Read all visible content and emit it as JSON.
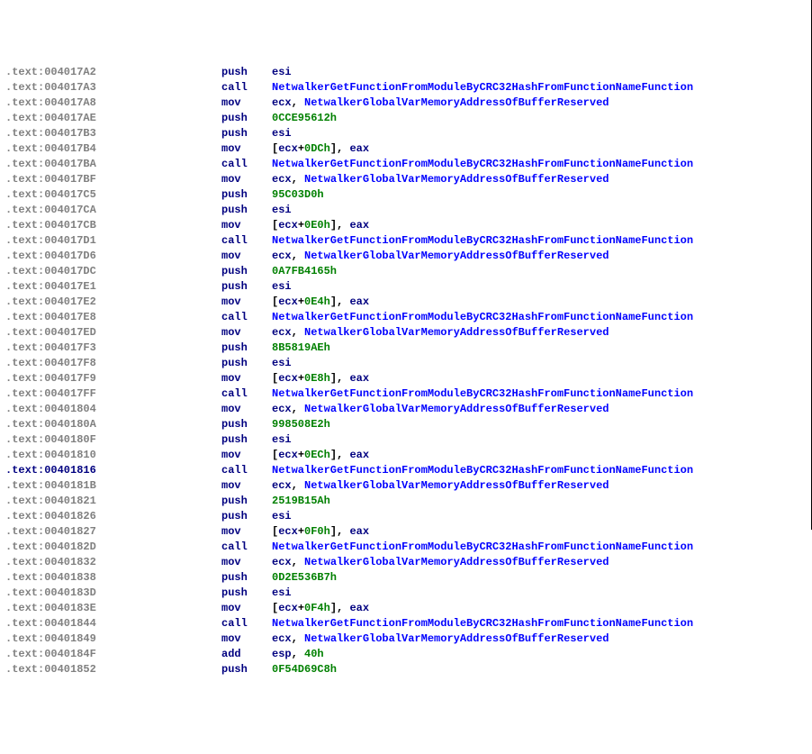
{
  "lines": [
    {
      "addr": ".text:004017A2",
      "sel": false,
      "mnem": "push",
      "ops": [
        {
          "t": "reg",
          "v": "esi"
        }
      ]
    },
    {
      "addr": ".text:004017A3",
      "sel": false,
      "mnem": "call",
      "ops": [
        {
          "t": "sym",
          "v": "NetwalkerGetFunctionFromModuleByCRC32HashFromFunctionNameFunction"
        }
      ]
    },
    {
      "addr": ".text:004017A8",
      "sel": false,
      "mnem": "mov",
      "ops": [
        {
          "t": "reg",
          "v": "ecx"
        },
        {
          "t": "plain",
          "v": ", "
        },
        {
          "t": "sym",
          "v": "NetwalkerGlobalVarMemoryAddressOfBufferReserved"
        }
      ]
    },
    {
      "addr": ".text:004017AE",
      "sel": false,
      "mnem": "push",
      "ops": [
        {
          "t": "num",
          "v": "0CCE95612h"
        }
      ]
    },
    {
      "addr": ".text:004017B3",
      "sel": false,
      "mnem": "push",
      "ops": [
        {
          "t": "reg",
          "v": "esi"
        }
      ]
    },
    {
      "addr": ".text:004017B4",
      "sel": false,
      "mnem": "mov",
      "ops": [
        {
          "t": "plain",
          "v": "["
        },
        {
          "t": "reg",
          "v": "ecx"
        },
        {
          "t": "plain",
          "v": "+"
        },
        {
          "t": "num",
          "v": "0DCh"
        },
        {
          "t": "plain",
          "v": "], "
        },
        {
          "t": "reg",
          "v": "eax"
        }
      ]
    },
    {
      "addr": ".text:004017BA",
      "sel": false,
      "mnem": "call",
      "ops": [
        {
          "t": "sym",
          "v": "NetwalkerGetFunctionFromModuleByCRC32HashFromFunctionNameFunction"
        }
      ]
    },
    {
      "addr": ".text:004017BF",
      "sel": false,
      "mnem": "mov",
      "ops": [
        {
          "t": "reg",
          "v": "ecx"
        },
        {
          "t": "plain",
          "v": ", "
        },
        {
          "t": "sym",
          "v": "NetwalkerGlobalVarMemoryAddressOfBufferReserved"
        }
      ]
    },
    {
      "addr": ".text:004017C5",
      "sel": false,
      "mnem": "push",
      "ops": [
        {
          "t": "num",
          "v": "95C03D0h"
        }
      ]
    },
    {
      "addr": ".text:004017CA",
      "sel": false,
      "mnem": "push",
      "ops": [
        {
          "t": "reg",
          "v": "esi"
        }
      ]
    },
    {
      "addr": ".text:004017CB",
      "sel": false,
      "mnem": "mov",
      "ops": [
        {
          "t": "plain",
          "v": "["
        },
        {
          "t": "reg",
          "v": "ecx"
        },
        {
          "t": "plain",
          "v": "+"
        },
        {
          "t": "num",
          "v": "0E0h"
        },
        {
          "t": "plain",
          "v": "], "
        },
        {
          "t": "reg",
          "v": "eax"
        }
      ]
    },
    {
      "addr": ".text:004017D1",
      "sel": false,
      "mnem": "call",
      "ops": [
        {
          "t": "sym",
          "v": "NetwalkerGetFunctionFromModuleByCRC32HashFromFunctionNameFunction"
        }
      ]
    },
    {
      "addr": ".text:004017D6",
      "sel": false,
      "mnem": "mov",
      "ops": [
        {
          "t": "reg",
          "v": "ecx"
        },
        {
          "t": "plain",
          "v": ", "
        },
        {
          "t": "sym",
          "v": "NetwalkerGlobalVarMemoryAddressOfBufferReserved"
        }
      ]
    },
    {
      "addr": ".text:004017DC",
      "sel": false,
      "mnem": "push",
      "ops": [
        {
          "t": "num",
          "v": "0A7FB4165h"
        }
      ]
    },
    {
      "addr": ".text:004017E1",
      "sel": false,
      "mnem": "push",
      "ops": [
        {
          "t": "reg",
          "v": "esi"
        }
      ]
    },
    {
      "addr": ".text:004017E2",
      "sel": false,
      "mnem": "mov",
      "ops": [
        {
          "t": "plain",
          "v": "["
        },
        {
          "t": "reg",
          "v": "ecx"
        },
        {
          "t": "plain",
          "v": "+"
        },
        {
          "t": "num",
          "v": "0E4h"
        },
        {
          "t": "plain",
          "v": "], "
        },
        {
          "t": "reg",
          "v": "eax"
        }
      ]
    },
    {
      "addr": ".text:004017E8",
      "sel": false,
      "mnem": "call",
      "ops": [
        {
          "t": "sym",
          "v": "NetwalkerGetFunctionFromModuleByCRC32HashFromFunctionNameFunction"
        }
      ]
    },
    {
      "addr": ".text:004017ED",
      "sel": false,
      "mnem": "mov",
      "ops": [
        {
          "t": "reg",
          "v": "ecx"
        },
        {
          "t": "plain",
          "v": ", "
        },
        {
          "t": "sym",
          "v": "NetwalkerGlobalVarMemoryAddressOfBufferReserved"
        }
      ]
    },
    {
      "addr": ".text:004017F3",
      "sel": false,
      "mnem": "push",
      "ops": [
        {
          "t": "num",
          "v": "8B5819AEh"
        }
      ]
    },
    {
      "addr": ".text:004017F8",
      "sel": false,
      "mnem": "push",
      "ops": [
        {
          "t": "reg",
          "v": "esi"
        }
      ]
    },
    {
      "addr": ".text:004017F9",
      "sel": false,
      "mnem": "mov",
      "ops": [
        {
          "t": "plain",
          "v": "["
        },
        {
          "t": "reg",
          "v": "ecx"
        },
        {
          "t": "plain",
          "v": "+"
        },
        {
          "t": "num",
          "v": "0E8h"
        },
        {
          "t": "plain",
          "v": "], "
        },
        {
          "t": "reg",
          "v": "eax"
        }
      ]
    },
    {
      "addr": ".text:004017FF",
      "sel": false,
      "mnem": "call",
      "ops": [
        {
          "t": "sym",
          "v": "NetwalkerGetFunctionFromModuleByCRC32HashFromFunctionNameFunction"
        }
      ]
    },
    {
      "addr": ".text:00401804",
      "sel": false,
      "mnem": "mov",
      "ops": [
        {
          "t": "reg",
          "v": "ecx"
        },
        {
          "t": "plain",
          "v": ", "
        },
        {
          "t": "sym",
          "v": "NetwalkerGlobalVarMemoryAddressOfBufferReserved"
        }
      ]
    },
    {
      "addr": ".text:0040180A",
      "sel": false,
      "mnem": "push",
      "ops": [
        {
          "t": "num",
          "v": "998508E2h"
        }
      ]
    },
    {
      "addr": ".text:0040180F",
      "sel": false,
      "mnem": "push",
      "ops": [
        {
          "t": "reg",
          "v": "esi"
        }
      ]
    },
    {
      "addr": ".text:00401810",
      "sel": false,
      "mnem": "mov",
      "ops": [
        {
          "t": "plain",
          "v": "["
        },
        {
          "t": "reg",
          "v": "ecx"
        },
        {
          "t": "plain",
          "v": "+"
        },
        {
          "t": "num",
          "v": "0ECh"
        },
        {
          "t": "plain",
          "v": "], "
        },
        {
          "t": "reg",
          "v": "eax"
        }
      ]
    },
    {
      "addr": ".text:00401816",
      "sel": true,
      "mnem": "call",
      "ops": [
        {
          "t": "sym",
          "v": "NetwalkerGetFunctionFromModuleByCRC32HashFromFunctionNameFunction"
        }
      ]
    },
    {
      "addr": ".text:0040181B",
      "sel": false,
      "mnem": "mov",
      "ops": [
        {
          "t": "reg",
          "v": "ecx"
        },
        {
          "t": "plain",
          "v": ", "
        },
        {
          "t": "sym",
          "v": "NetwalkerGlobalVarMemoryAddressOfBufferReserved"
        }
      ]
    },
    {
      "addr": ".text:00401821",
      "sel": false,
      "mnem": "push",
      "ops": [
        {
          "t": "num",
          "v": "2519B15Ah"
        }
      ]
    },
    {
      "addr": ".text:00401826",
      "sel": false,
      "mnem": "push",
      "ops": [
        {
          "t": "reg",
          "v": "esi"
        }
      ]
    },
    {
      "addr": ".text:00401827",
      "sel": false,
      "mnem": "mov",
      "ops": [
        {
          "t": "plain",
          "v": "["
        },
        {
          "t": "reg",
          "v": "ecx"
        },
        {
          "t": "plain",
          "v": "+"
        },
        {
          "t": "num",
          "v": "0F0h"
        },
        {
          "t": "plain",
          "v": "], "
        },
        {
          "t": "reg",
          "v": "eax"
        }
      ]
    },
    {
      "addr": ".text:0040182D",
      "sel": false,
      "mnem": "call",
      "ops": [
        {
          "t": "sym",
          "v": "NetwalkerGetFunctionFromModuleByCRC32HashFromFunctionNameFunction"
        }
      ]
    },
    {
      "addr": ".text:00401832",
      "sel": false,
      "mnem": "mov",
      "ops": [
        {
          "t": "reg",
          "v": "ecx"
        },
        {
          "t": "plain",
          "v": ", "
        },
        {
          "t": "sym",
          "v": "NetwalkerGlobalVarMemoryAddressOfBufferReserved"
        }
      ]
    },
    {
      "addr": ".text:00401838",
      "sel": false,
      "mnem": "push",
      "ops": [
        {
          "t": "num",
          "v": "0D2E536B7h"
        }
      ]
    },
    {
      "addr": ".text:0040183D",
      "sel": false,
      "mnem": "push",
      "ops": [
        {
          "t": "reg",
          "v": "esi"
        }
      ]
    },
    {
      "addr": ".text:0040183E",
      "sel": false,
      "mnem": "mov",
      "ops": [
        {
          "t": "plain",
          "v": "["
        },
        {
          "t": "reg",
          "v": "ecx"
        },
        {
          "t": "plain",
          "v": "+"
        },
        {
          "t": "num",
          "v": "0F4h"
        },
        {
          "t": "plain",
          "v": "], "
        },
        {
          "t": "reg",
          "v": "eax"
        }
      ]
    },
    {
      "addr": ".text:00401844",
      "sel": false,
      "mnem": "call",
      "ops": [
        {
          "t": "sym",
          "v": "NetwalkerGetFunctionFromModuleByCRC32HashFromFunctionNameFunction"
        }
      ]
    },
    {
      "addr": ".text:00401849",
      "sel": false,
      "mnem": "mov",
      "ops": [
        {
          "t": "reg",
          "v": "ecx"
        },
        {
          "t": "plain",
          "v": ", "
        },
        {
          "t": "sym",
          "v": "NetwalkerGlobalVarMemoryAddressOfBufferReserved"
        }
      ]
    },
    {
      "addr": ".text:0040184F",
      "sel": false,
      "mnem": "add",
      "ops": [
        {
          "t": "reg",
          "v": "esp"
        },
        {
          "t": "plain",
          "v": ", "
        },
        {
          "t": "num",
          "v": "40h"
        }
      ]
    },
    {
      "addr": ".text:00401852",
      "sel": false,
      "mnem": "push",
      "ops": [
        {
          "t": "num",
          "v": "0F54D69C8h"
        }
      ]
    }
  ]
}
